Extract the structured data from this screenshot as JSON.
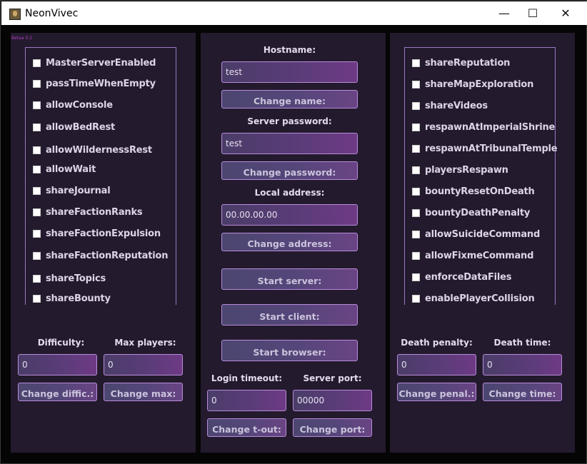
{
  "window": {
    "title": "NeonVivec",
    "minimize": "—",
    "maximize": "☐",
    "close": "✕"
  },
  "version": "Betaа 0.2",
  "left": {
    "checkboxes": [
      "MasterServerEnabled",
      "passTimeWhenEmpty",
      "allowConsole",
      "allowBedRest",
      "allowWildernessRest",
      "allowWait",
      "shareJournal",
      "shareFactionRanks",
      "shareFactionExpulsion",
      "shareFactionReputation",
      "shareTopics",
      "shareBounty"
    ],
    "difficulty_label": "Difficulty:",
    "difficulty_value": "0",
    "difficulty_button": "Change diffic.:",
    "maxplayers_label": "Max players:",
    "maxplayers_value": "0",
    "maxplayers_button": "Change max:"
  },
  "center": {
    "hostname_label": "Hostname:",
    "hostname_value": "test",
    "hostname_button": "Change name:",
    "password_label": "Server password:",
    "password_value": "test",
    "password_button": "Change password:",
    "address_label": "Local address:",
    "address_value": "00.00.00.00",
    "address_button": "Change address:",
    "start_server": "Start server:",
    "start_client": "Start client:",
    "start_browser": "Start browser:",
    "timeout_label": "Login timeout:",
    "timeout_value": "0",
    "timeout_button": "Change t-out:",
    "port_label": "Server port:",
    "port_value": "00000",
    "port_button": "Change port:"
  },
  "right": {
    "checkboxes": [
      "shareReputation",
      "shareMapExploration",
      "shareVideos",
      "respawnAtImperialShrine",
      "respawnAtTribunalTemple",
      "playersRespawn",
      "bountyResetOnDeath",
      "bountyDeathPenalty",
      "allowSuicideCommand",
      "allowFixmeCommand",
      "enforceDataFiles",
      "enablePlayerCollision"
    ],
    "deathpenalty_label": "Death penalty:",
    "deathpenalty_value": "0",
    "deathpenalty_button": "Change penal.:",
    "deathtime_label": "Death time:",
    "deathtime_value": "0",
    "deathtime_button": "Change time:"
  },
  "colors": {
    "panel": "#231a2d",
    "accent": "#b88cda",
    "background": "#050505"
  }
}
